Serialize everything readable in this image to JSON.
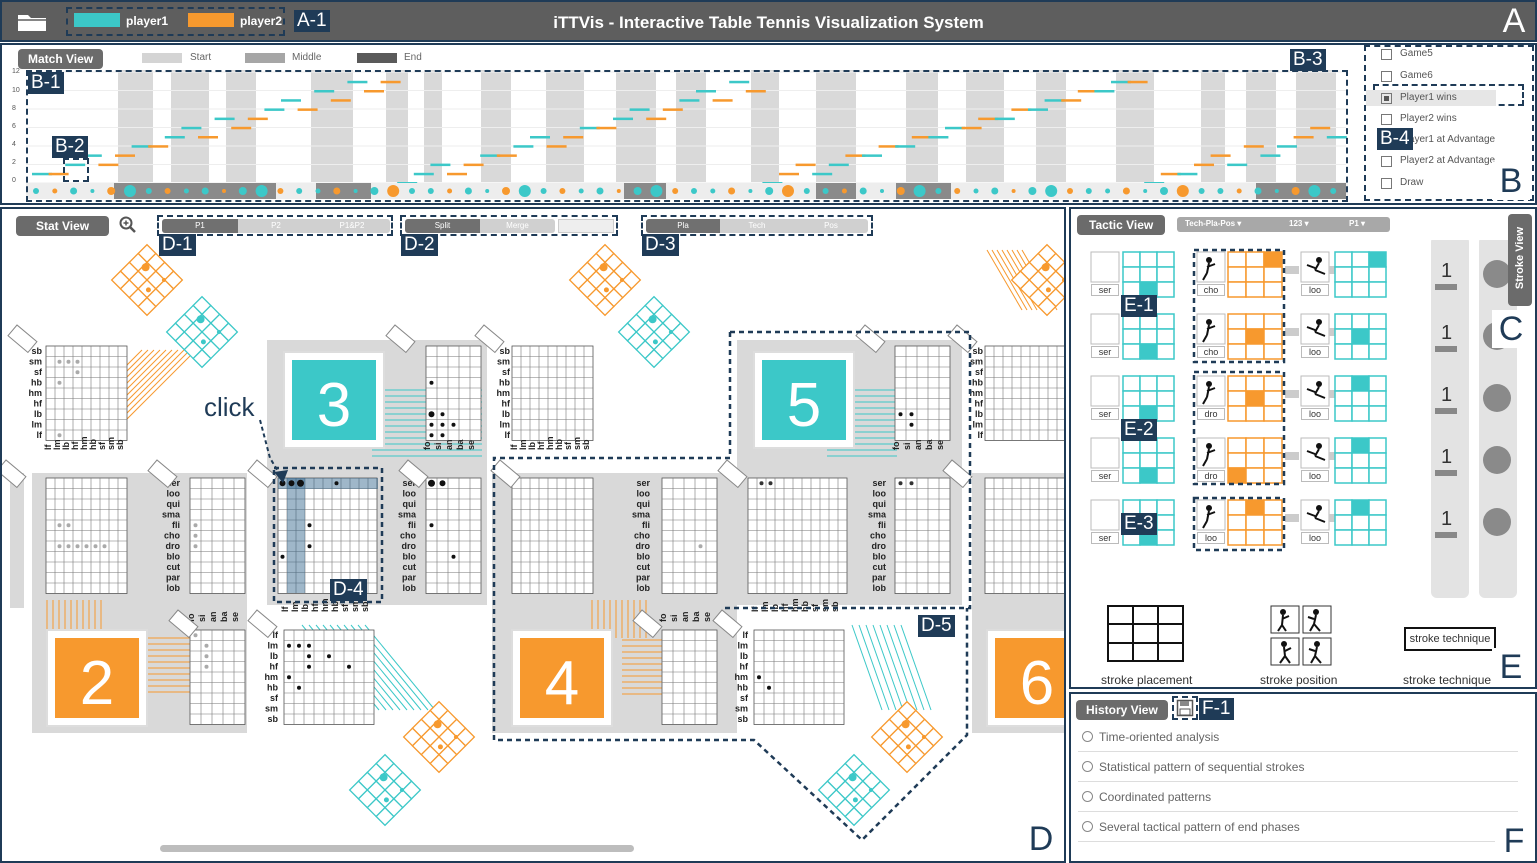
{
  "app": {
    "title": "iTTVis - Interactive Table Tennis Visualization System"
  },
  "legend": [
    {
      "label": "player1",
      "color": "#3cc8c8"
    },
    {
      "label": "player2",
      "color": "#f7992e"
    }
  ],
  "colors": {
    "player1": "#3cc8c8",
    "player2": "#f7992e",
    "frame": "#1f3b57",
    "header": "#5e5e5e"
  },
  "panel_tags": {
    "A": "A",
    "A1": "A-1",
    "B": "B",
    "B1": "B-1",
    "B2": "B-2",
    "B3": "B-3",
    "B4": "B-4",
    "C": "C",
    "D": "D",
    "D1": "D-1",
    "D2": "D-2",
    "D3": "D-3",
    "D4": "D-4",
    "D5": "D-5",
    "E": "E",
    "E1": "E-1",
    "E2": "E-2",
    "E3": "E-3",
    "F": "F",
    "F1": "F-1"
  },
  "match_view": {
    "title": "Match View",
    "phase_legend": [
      "Start",
      "Middle",
      "End"
    ],
    "y_ticks": [
      "12",
      "10",
      "8",
      "6",
      "4",
      "2",
      "0"
    ],
    "filters": [
      {
        "label": "Game5",
        "checked": false
      },
      {
        "label": "Game6",
        "checked": false
      },
      {
        "label": "Player1 wins",
        "checked": true
      },
      {
        "label": "Player2 wins",
        "checked": false
      },
      {
        "label": "Player1 at Advantage",
        "checked": false
      },
      {
        "label": "Player2 at Advantage",
        "checked": false
      },
      {
        "label": "Draw",
        "checked": false
      }
    ]
  },
  "stat_view": {
    "title": "Stat View",
    "player_toggle": [
      "P1",
      "P2",
      "P1&P2"
    ],
    "split_toggle": [
      "Split",
      "Merge"
    ],
    "attr_toggle": [
      "Pla",
      "Tech",
      "Pos"
    ],
    "click_label": "click",
    "stroke_numbers": [
      "2",
      "3",
      "4",
      "5",
      "6"
    ],
    "tech_labels": [
      "ser",
      "loo",
      "qui",
      "sma",
      "fli",
      "cho",
      "dro",
      "blo",
      "cut",
      "par",
      "lob"
    ],
    "pos_labels": [
      "fo",
      "si",
      "an",
      "ba",
      "se"
    ],
    "pla_labels": [
      "sb",
      "sm",
      "sf",
      "hb",
      "hm",
      "hf",
      "lb",
      "lm",
      "lf"
    ],
    "pla_labels_rev": [
      "lf",
      "lm",
      "lb",
      "hf",
      "hm",
      "hb",
      "sf",
      "sm",
      "sb"
    ]
  },
  "tactic_view": {
    "title": "Tactic View",
    "dropdowns": [
      "Tech-Pla-Pos ▾",
      "123 ▾",
      "P1 ▾"
    ],
    "rows": [
      {
        "t1": "ser",
        "t2": "cho",
        "t3": "loo",
        "count": "1"
      },
      {
        "t1": "ser",
        "t2": "cho",
        "t3": "loo",
        "count": "1"
      },
      {
        "t1": "ser",
        "t2": "dro",
        "t3": "loo",
        "count": "1"
      },
      {
        "t1": "ser",
        "t2": "dro",
        "t3": "loo",
        "count": "1"
      },
      {
        "t1": "ser",
        "t2": "loo",
        "t3": "loo",
        "count": "1"
      }
    ],
    "legend": {
      "placement": "stroke placement",
      "position": "stroke position",
      "technique": "stroke technique",
      "technique_box": "stroke technique"
    },
    "stroke_view_tab": "Stroke View"
  },
  "history_view": {
    "title": "History View",
    "items": [
      "Time-oriented analysis",
      "Statistical pattern of sequential strokes",
      "Coordinated patterns",
      "Several tactical pattern of end phases"
    ]
  }
}
